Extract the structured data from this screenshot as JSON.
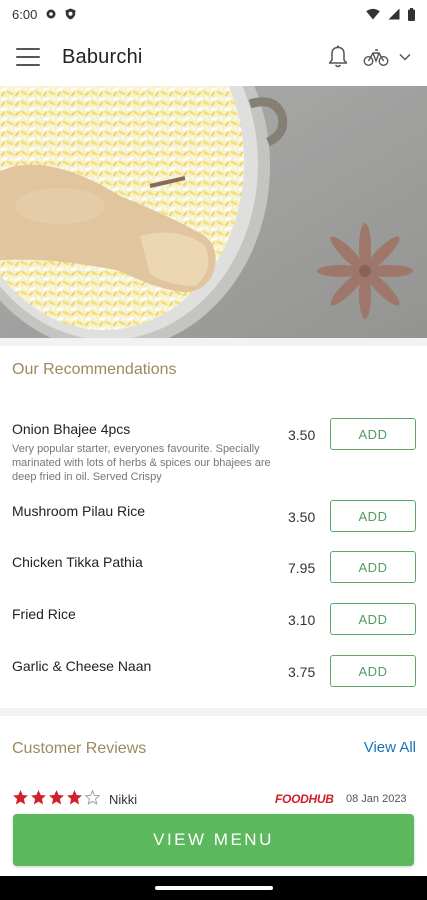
{
  "status_bar": {
    "time": "6:00",
    "icons": [
      "gear-icon",
      "shield-icon",
      "wifi-icon",
      "signal-icon",
      "battery-icon"
    ]
  },
  "app_bar": {
    "title": "Baburchi",
    "icons": [
      "menu-icon",
      "bell-icon",
      "bike-icon",
      "chevron-down-icon"
    ]
  },
  "hero": {
    "description_icon": "biryani-photo"
  },
  "recommendations": {
    "title": "Our Recommendations",
    "items": [
      {
        "name": "Onion Bhajee 4pcs",
        "description": "Very popular starter, everyones favourite. Specially marinated with lots of herbs & spices our bhajees are deep fried in oil. Served Crispy",
        "price": "3.50",
        "button": "ADD"
      },
      {
        "name": "Mushroom Pilau Rice",
        "description": "",
        "price": "3.50",
        "button": "ADD"
      },
      {
        "name": "Chicken Tikka Pathia",
        "description": "",
        "price": "7.95",
        "button": "ADD"
      },
      {
        "name": "Fried Rice",
        "description": "",
        "price": "3.10",
        "button": "ADD"
      },
      {
        "name": "Garlic & Cheese Naan",
        "description": "",
        "price": "3.75",
        "button": "ADD"
      }
    ]
  },
  "reviews": {
    "title": "Customer Reviews",
    "view_all": "View All",
    "items": [
      {
        "rating": 4,
        "max_rating": 5,
        "reviewer": "Nikki",
        "source": "FOODHUB",
        "date": "08 Jan 2023"
      }
    ]
  },
  "footer": {
    "view_menu": "VIEW MENU"
  },
  "colors": {
    "accent_green": "#5cb85c",
    "section_title": "#9c8a5e",
    "link_blue": "#1a73b8",
    "star_red": "#d0202b"
  }
}
